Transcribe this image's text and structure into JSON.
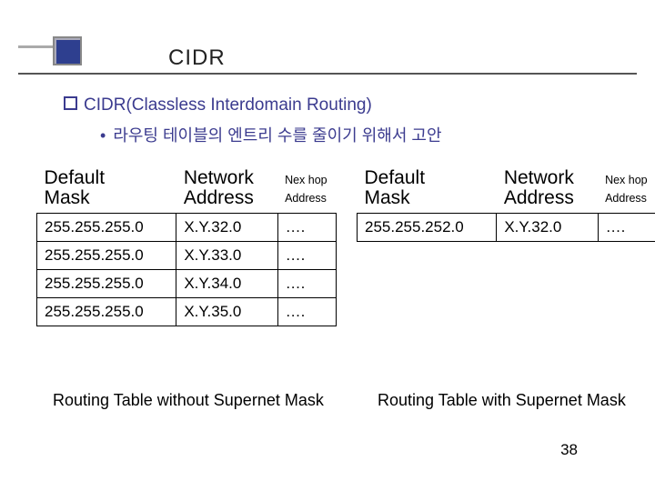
{
  "slide": {
    "title": "CIDR",
    "heading": "CIDR(Classless Interdomain Routing)",
    "subpoint": "라우팅 테이블의 엔트리 수를 줄이기 위해서 고안",
    "page_number": "38"
  },
  "left_table": {
    "headers": {
      "col0_line1": "Default",
      "col0_line2": "Mask",
      "col1_line1": "Network",
      "col1_line2": "Address",
      "col2_line1": "Nex hop",
      "col2_line2": "Address"
    },
    "rows": [
      {
        "mask": "255.255.255.0",
        "net": "X.Y.32.0",
        "hop": "…."
      },
      {
        "mask": "255.255.255.0",
        "net": "X.Y.33.0",
        "hop": "…."
      },
      {
        "mask": "255.255.255.0",
        "net": "X.Y.34.0",
        "hop": "…."
      },
      {
        "mask": "255.255.255.0",
        "net": "X.Y.35.0",
        "hop": "…."
      }
    ],
    "caption": "Routing Table without Supernet Mask"
  },
  "right_table": {
    "headers": {
      "col0_line1": "Default",
      "col0_line2": "Mask",
      "col1_line1": "Network",
      "col1_line2": "Address",
      "col2_line1": "Nex hop",
      "col2_line2": "Address"
    },
    "rows": [
      {
        "mask": "255.255.252.0",
        "net": "X.Y.32.0",
        "hop": "…."
      }
    ],
    "caption": "Routing Table with Supernet Mask"
  }
}
